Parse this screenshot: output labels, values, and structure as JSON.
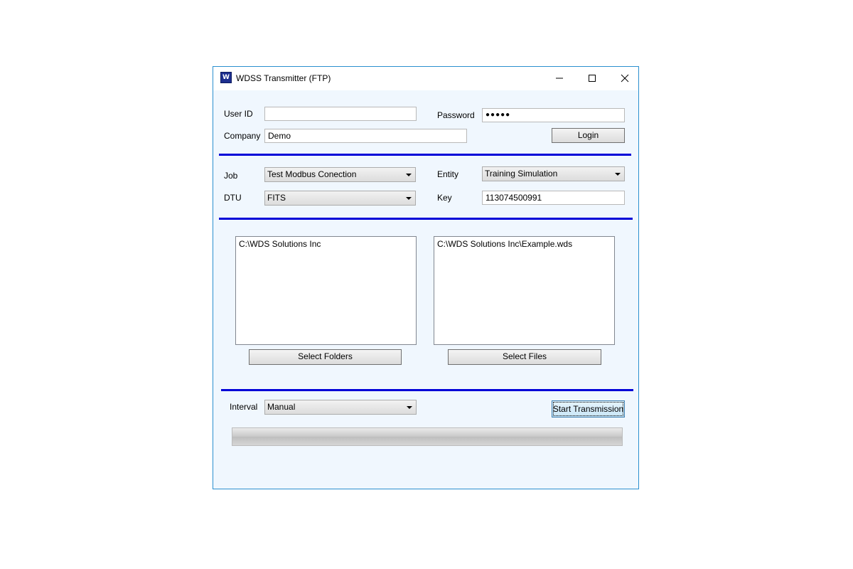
{
  "window": {
    "title": "WDSS Transmitter (FTP)",
    "icon": "W",
    "accent": "#0000d8"
  },
  "login": {
    "user_id_label": "User ID",
    "user_id_value": "",
    "password_label": "Password",
    "password_value": "●●●●●",
    "company_label": "Company",
    "company_value": "Demo",
    "login_button": "Login"
  },
  "job": {
    "job_label": "Job",
    "job_value": "Test Modbus Conection",
    "entity_label": "Entity",
    "entity_value": "Training Simulation",
    "dtu_label": "DTU",
    "dtu_value": "FITS",
    "key_label": "Key",
    "key_value": "113074500991"
  },
  "files": {
    "folders": [
      "C:\\WDS Solutions Inc"
    ],
    "files": [
      "C:\\WDS Solutions Inc\\Example.wds"
    ],
    "select_folders_button": "Select Folders",
    "select_files_button": "Select Files"
  },
  "transmit": {
    "interval_label": "Interval",
    "interval_value": "Manual",
    "start_button": "Start Transmission",
    "progress": 0
  }
}
